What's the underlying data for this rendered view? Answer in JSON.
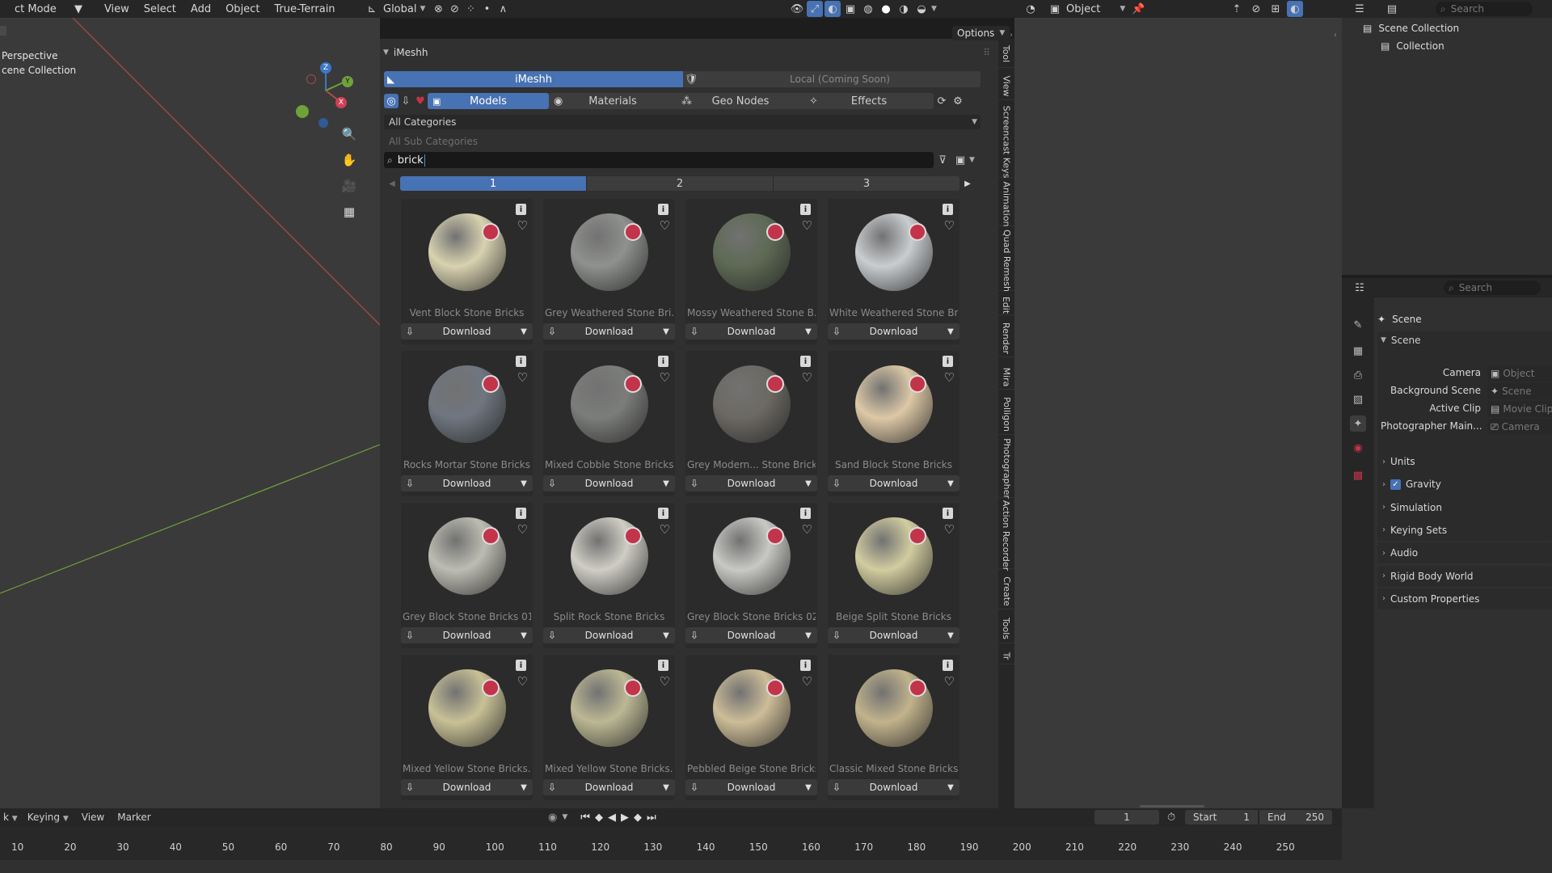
{
  "topbar": {
    "mode": "ct Mode",
    "menus": [
      "View",
      "Select",
      "Add",
      "Object",
      "True-Terrain"
    ],
    "transform_orientation": "Global",
    "object_mode": "Object",
    "search_placeholder": "Search"
  },
  "viewport": {
    "label_line1": "Perspective",
    "label_line2": "cene Collection",
    "options_label": "Options",
    "axis_x": "X",
    "axis_y": "Y",
    "axis_z": "Z"
  },
  "addon": {
    "header": "iMeshh",
    "tab_active": "iMeshh",
    "tab_local": "Local (Coming Soon)",
    "tabs": [
      "Models",
      "Materials",
      "Geo Nodes",
      "Effects"
    ],
    "category": "All Categories",
    "sub_category": "All Sub Categories",
    "search_value": "brick",
    "pages": [
      "1",
      "2",
      "3"
    ],
    "download_label": "Download",
    "info_glyph": "i",
    "assets": [
      {
        "name": "Vent Block Stone Bricks",
        "color": "#d8d2b0"
      },
      {
        "name": "Grey Weathered Stone Bri...",
        "color": "#8e918d"
      },
      {
        "name": "Mossy Weathered Stone B...",
        "color": "#5e6a55"
      },
      {
        "name": "White Weathered Stone Br...",
        "color": "#c9cdd0"
      },
      {
        "name": "Rocks Mortar Stone Bricks",
        "color": "#6f767f"
      },
      {
        "name": "Mixed Cobble Stone Bricks",
        "color": "#7b7d7a"
      },
      {
        "name": "Grey Modern... Stone Bricks",
        "color": "#6c6963"
      },
      {
        "name": "Sand Block Stone Bricks",
        "color": "#ddc8a6"
      },
      {
        "name": "Grey Block Stone Bricks 01",
        "color": "#bdbcb2"
      },
      {
        "name": "Split Rock Stone Bricks",
        "color": "#cfcdc4"
      },
      {
        "name": "Grey Block Stone Bricks 02",
        "color": "#c8c8c4"
      },
      {
        "name": "Beige Split Stone Bricks",
        "color": "#d2cca0"
      },
      {
        "name": "Mixed Yellow Stone Bricks...",
        "color": "#c8c196"
      },
      {
        "name": "Mixed Yellow Stone Bricks...",
        "color": "#bcb894"
      },
      {
        "name": "Pebbled Beige Stone Bricks",
        "color": "#cdbd98"
      },
      {
        "name": "Classic Mixed Stone Bricks",
        "color": "#c2b38c"
      }
    ]
  },
  "side_tabs": [
    "Tool",
    "View",
    "Screencast Keys",
    "Animation",
    "Quad Remesh",
    "Edit",
    "Render",
    "Mira",
    "Polligon",
    "Photographer",
    "Action Recorder",
    "Create",
    "Tools",
    "Tr"
  ],
  "outliner": {
    "root": "Scene Collection",
    "child": "Collection"
  },
  "properties": {
    "search_placeholder": "Search",
    "context": "Scene",
    "section": "Scene",
    "fields": [
      {
        "label": "Camera",
        "value": "Object"
      },
      {
        "label": "Background Scene",
        "value": "Scene"
      },
      {
        "label": "Active Clip",
        "value": "Movie Clip"
      },
      {
        "label": "Photographer Main...",
        "value": "Camera"
      }
    ],
    "panels": [
      "Units",
      "Gravity",
      "Simulation",
      "Keying Sets",
      "Audio",
      "Rigid Body World",
      "Custom Properties"
    ]
  },
  "timeline": {
    "menus": [
      "k",
      "Keying",
      "View",
      "Marker"
    ],
    "current_frame": "1",
    "start_label": "Start",
    "start_value": "1",
    "end_label": "End",
    "end_value": "250",
    "ruler": [
      "10",
      "20",
      "30",
      "40",
      "50",
      "60",
      "70",
      "80",
      "90",
      "100",
      "110",
      "120",
      "130",
      "140",
      "150",
      "160",
      "170",
      "180",
      "190",
      "200",
      "210",
      "220",
      "230",
      "240",
      "250"
    ]
  }
}
